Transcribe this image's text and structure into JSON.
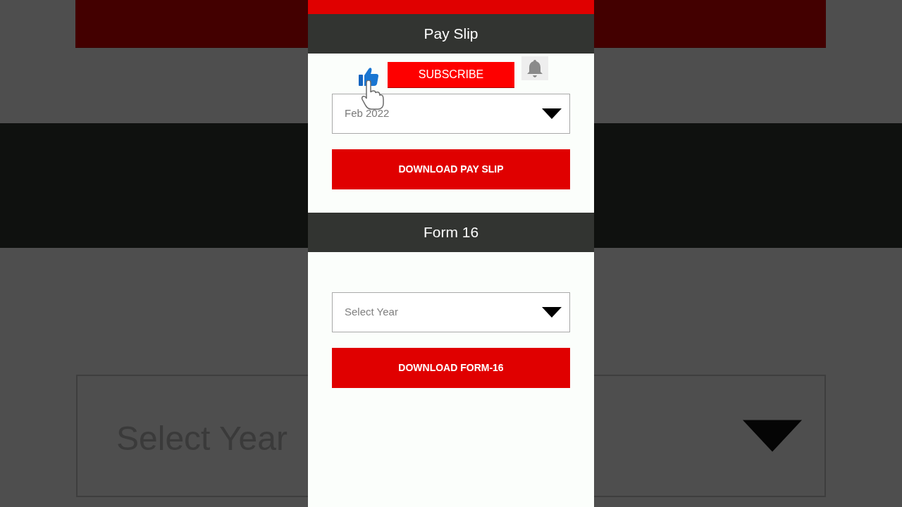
{
  "background": {
    "select": {
      "placeholder": "Select Year"
    }
  },
  "overlay": {
    "subscribe_button": "SUBSCRIBE"
  },
  "sections": [
    {
      "title": "Pay Slip",
      "select": {
        "value": "Feb 2022"
      },
      "button": "DOWNLOAD PAY SLIP"
    },
    {
      "title": "Form 16",
      "select": {
        "placeholder": "Select Year"
      },
      "button": "DOWNLOAD FORM-16"
    }
  ]
}
